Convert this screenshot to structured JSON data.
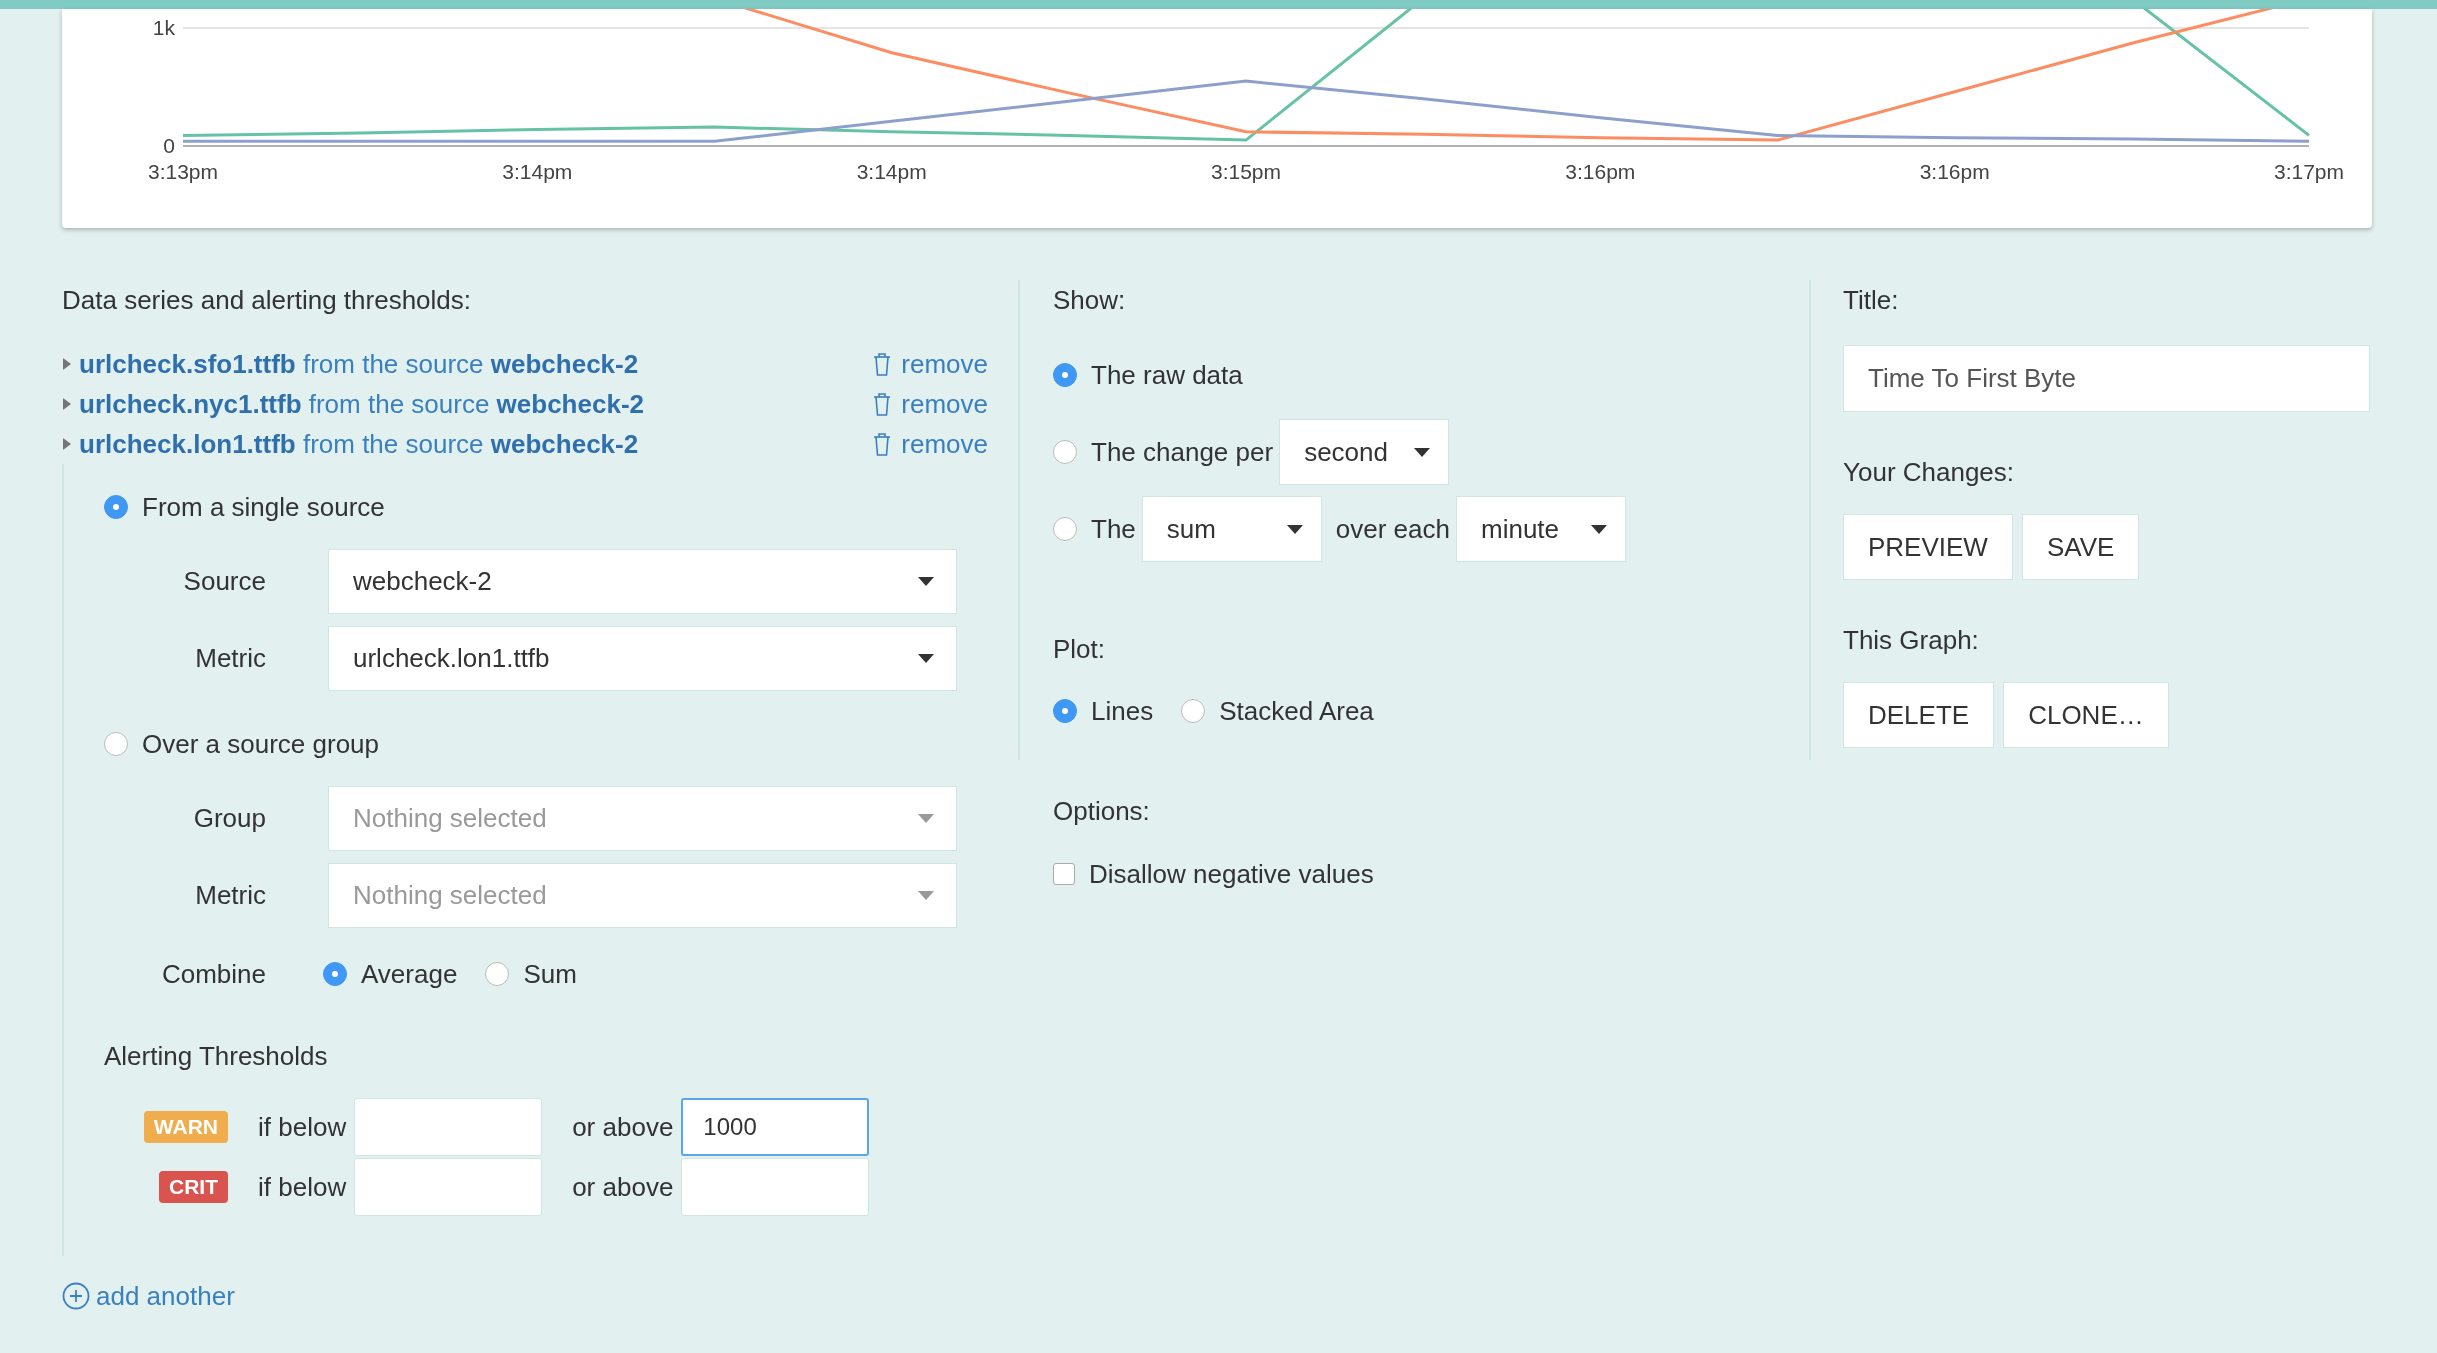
{
  "chart": {
    "chart_data": {
      "type": "line",
      "categories": [
        "3:13pm",
        null,
        "3:14pm",
        null,
        "3:14pm",
        null,
        "3:15pm",
        null,
        "3:16pm",
        null,
        "3:16pm",
        null,
        "3:17pm"
      ],
      "ylim": [
        0,
        1000
      ],
      "yticks": [
        0,
        {
          "value": 1000,
          "label": "1k"
        }
      ],
      "series": [
        {
          "color": "#66c2a5",
          "values": [
            90,
            110,
            140,
            160,
            120,
            90,
            50,
            null,
            null,
            null,
            null,
            null,
            90
          ]
        },
        {
          "color": "#fc8d62",
          "values": [
            null,
            null,
            null,
            null,
            790,
            450,
            120,
            100,
            70,
            50,
            460,
            870,
            null
          ]
        },
        {
          "color": "#8da0cb",
          "values": [
            40,
            40,
            40,
            40,
            210,
            380,
            550,
            400,
            240,
            90,
            70,
            60,
            40
          ]
        }
      ]
    }
  },
  "series_panel": {
    "heading": "Data series and alerting thresholds:",
    "series": [
      {
        "metric": "urlcheck.sfo1.ttfb",
        "connector": "from the source",
        "source": "webcheck-2",
        "remove": "remove"
      },
      {
        "metric": "urlcheck.nyc1.ttfb",
        "connector": "from the source",
        "source": "webcheck-2",
        "remove": "remove"
      },
      {
        "metric": "urlcheck.lon1.ttfb",
        "connector": "from the source",
        "source": "webcheck-2",
        "remove": "remove"
      }
    ],
    "editor": {
      "single": {
        "label": "From a single source",
        "selected": true,
        "fields": [
          {
            "label": "Source",
            "value": "webcheck-2"
          },
          {
            "label": "Metric",
            "value": "urlcheck.lon1.ttfb"
          }
        ]
      },
      "group": {
        "label": "Over a source group",
        "selected": false,
        "fields": [
          {
            "label": "Group",
            "placeholder": "Nothing selected"
          },
          {
            "label": "Metric",
            "placeholder": "Nothing selected"
          }
        ],
        "combine": {
          "label": "Combine",
          "options": [
            {
              "label": "Average",
              "selected": true
            },
            {
              "label": "Sum",
              "selected": false
            }
          ]
        }
      },
      "thresholds": {
        "heading": "Alerting Thresholds",
        "rows": [
          {
            "badge": "WARN",
            "kind": "warn",
            "below_label": "if below",
            "above_label": "or above",
            "above_value": "1000",
            "above_focused": true
          },
          {
            "badge": "CRIT",
            "kind": "crit",
            "below_label": "if below",
            "above_label": "or above",
            "above_focused": false
          }
        ]
      }
    },
    "add_link": "add another"
  },
  "show": {
    "heading": "Show:",
    "options": [
      {
        "kind": "plain",
        "label": "The raw data",
        "selected": true
      },
      {
        "kind": "rate",
        "label": "The change per",
        "unit": "second",
        "selected": false
      },
      {
        "kind": "aggregate",
        "label": "The",
        "function": "sum",
        "connector": "over each",
        "period": "minute",
        "selected": false
      }
    ]
  },
  "plot": {
    "heading": "Plot:",
    "options": [
      {
        "label": "Lines",
        "selected": true
      },
      {
        "label": "Stacked Area",
        "selected": false
      }
    ]
  },
  "options": {
    "heading": "Options:",
    "checkboxes": [
      {
        "label": "Disallow negative values",
        "checked": false
      }
    ]
  },
  "title": {
    "heading": "Title:",
    "value": "Time To First Byte"
  },
  "changes": {
    "heading": "Your Changes:",
    "buttons": [
      "PREVIEW",
      "SAVE"
    ]
  },
  "graph": {
    "heading": "This Graph:",
    "buttons": [
      "DELETE",
      "CLONE…"
    ]
  }
}
